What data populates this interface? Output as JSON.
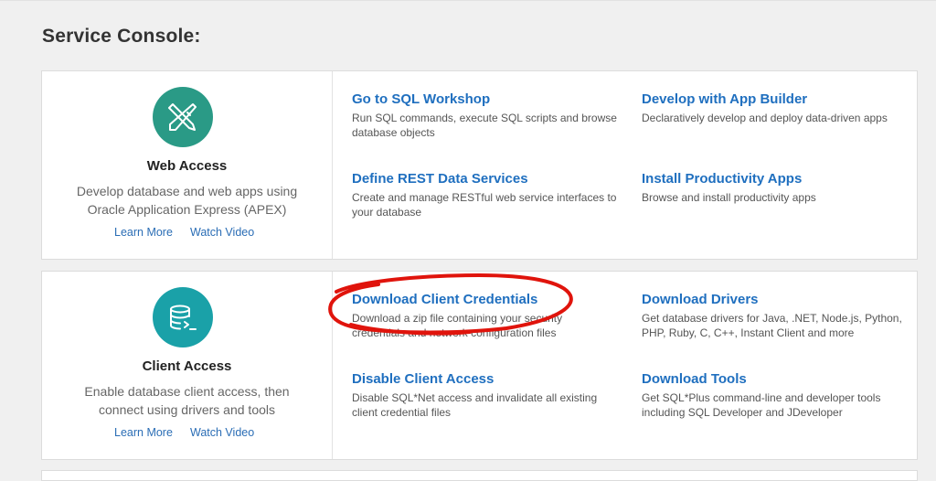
{
  "page_title": "Service Console:",
  "panels": [
    {
      "icon": "pencil-ruler-icon",
      "color": "#2a9a86",
      "title": "Web Access",
      "description": "Develop database and web apps using Oracle Application Express (APEX)",
      "learn_more": "Learn More",
      "watch_video": "Watch Video",
      "items": [
        {
          "title": "Go to SQL Workshop",
          "desc": "Run SQL commands, execute SQL scripts and browse database objects"
        },
        {
          "title": "Develop with App Builder",
          "desc": "Declaratively develop and deploy data-driven apps"
        },
        {
          "title": "Define REST Data Services",
          "desc": "Create and manage RESTful web service interfaces to your database"
        },
        {
          "title": "Install Productivity Apps",
          "desc": "Browse and install productivity apps"
        }
      ]
    },
    {
      "icon": "database-terminal-icon",
      "color": "#1aa1a8",
      "title": "Client Access",
      "description": "Enable database client access, then connect using drivers and tools",
      "learn_more": "Learn More",
      "watch_video": "Watch Video",
      "items": [
        {
          "title": "Download Client Credentials",
          "desc": "Download a zip file containing your security credentials and network configuration files"
        },
        {
          "title": "Download Drivers",
          "desc": "Get database drivers for Java, .NET, Node.js, Python, PHP, Ruby, C, C++, Instant Client and more"
        },
        {
          "title": "Disable Client Access",
          "desc": "Disable SQL*Net access and invalidate all existing client credential files"
        },
        {
          "title": "Download Tools",
          "desc": "Get SQL*Plus command-line and developer tools including SQL Developer and JDeveloper"
        }
      ]
    }
  ],
  "annotation": {
    "shape": "hand-drawn-ellipse",
    "color": "#e0140c"
  }
}
